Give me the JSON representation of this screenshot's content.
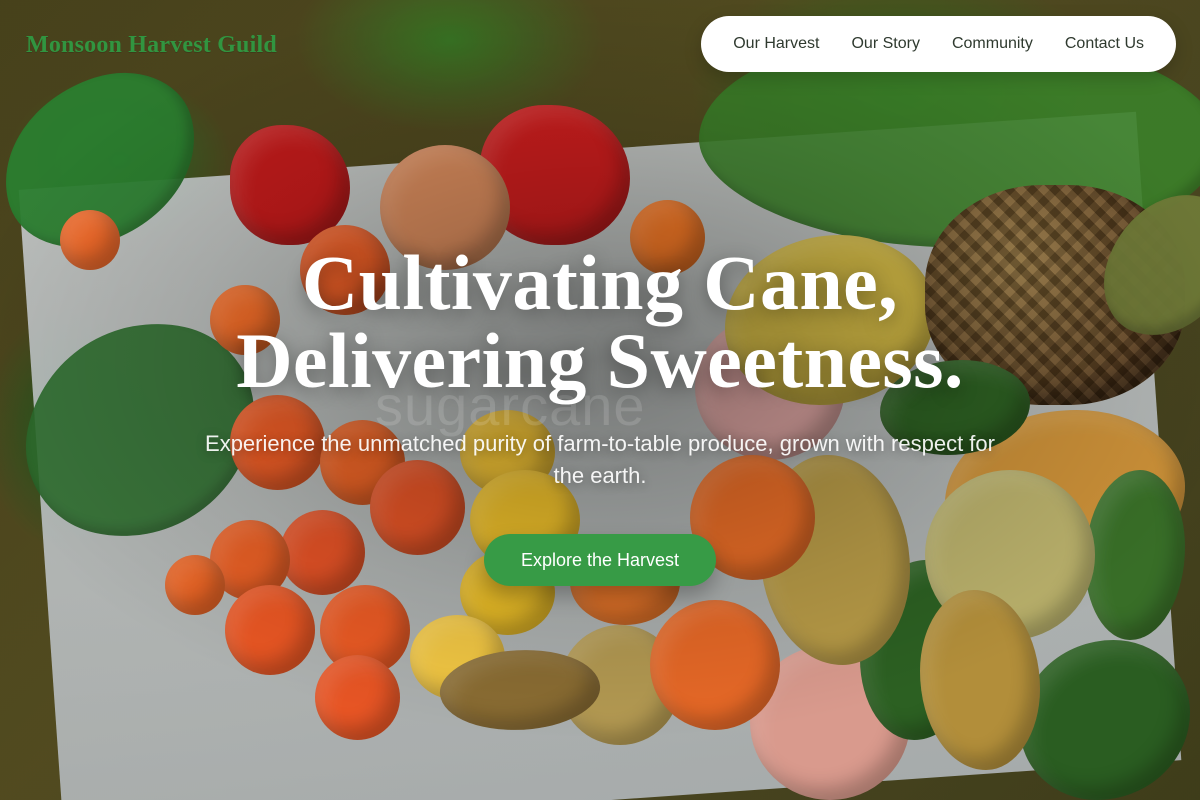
{
  "brand": {
    "name": "Monsoon Harvest Guild",
    "color": "#2f9e44"
  },
  "nav": {
    "items": [
      {
        "label": "Our Harvest"
      },
      {
        "label": "Our Story"
      },
      {
        "label": "Community"
      },
      {
        "label": "Contact Us"
      }
    ],
    "background": "#ffffff"
  },
  "hero": {
    "title_line1": "Cultivating Cane,",
    "title_line2": "Delivering Sweetness.",
    "subtitle": "Experience the unmatched purity of farm-to-table produce, grown with respect for the earth.",
    "cta_label": "Explore the Harvest",
    "cta_color": "#379b46",
    "background_subject": "fresh fruits and vegetables"
  },
  "watermark": "sugarcane"
}
